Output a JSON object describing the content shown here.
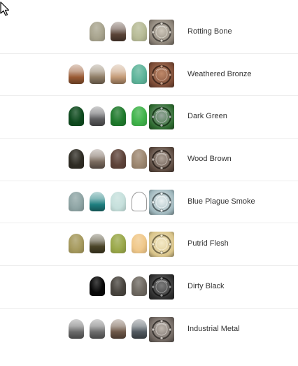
{
  "swatch_list": [
    {
      "name": "Rotting Bone",
      "paints": [
        {
          "style": "flat",
          "color": "#a8a48e"
        },
        {
          "style": "metal",
          "color": "#5a4438"
        },
        {
          "style": "flat",
          "color": "#b7bb96"
        }
      ],
      "mini": {
        "base": "#8a8176",
        "tint": "#cfc8bb"
      }
    },
    {
      "name": "Weathered Bronze",
      "paints": [
        {
          "style": "metal",
          "color": "#9a5a34"
        },
        {
          "style": "metal",
          "color": "#8f7d66"
        },
        {
          "style": "metal",
          "color": "#c49b77"
        },
        {
          "style": "flat",
          "color": "#5eb49a"
        }
      ],
      "mini": {
        "base": "#7a4a35",
        "tint": "#c08a6a"
      }
    },
    {
      "name": "Dark Green",
      "paints": [
        {
          "style": "flat",
          "color": "#0e4a1e"
        },
        {
          "style": "metal",
          "color": "#5e5e60"
        },
        {
          "style": "flat",
          "color": "#1f7a2c"
        },
        {
          "style": "flat",
          "color": "#3fb34a"
        }
      ],
      "mini": {
        "base": "#2e6b30",
        "tint": "#9aa8a0"
      }
    },
    {
      "name": "Wood Brown",
      "paints": [
        {
          "style": "flat",
          "color": "#2f2c24"
        },
        {
          "style": "metal",
          "color": "#7a6a5e"
        },
        {
          "style": "flat",
          "color": "#5e4339"
        },
        {
          "style": "flat",
          "color": "#9d8770"
        }
      ],
      "mini": {
        "base": "#5c4a40",
        "tint": "#b0a49a"
      }
    },
    {
      "name": "Blue Plague Smoke",
      "paints": [
        {
          "style": "flat",
          "color": "#8fa5a5"
        },
        {
          "style": "metal",
          "color": "#1f7f80"
        },
        {
          "style": "flat",
          "color": "#c6e0dc"
        },
        {
          "style": "outline",
          "color": "#ffffff"
        }
      ],
      "mini": {
        "base": "#9fb7bd",
        "tint": "#eaf1f2"
      }
    },
    {
      "name": "Putrid Flesh",
      "paints": [
        {
          "style": "flat",
          "color": "#a69a5e"
        },
        {
          "style": "metal",
          "color": "#4a4428"
        },
        {
          "style": "flat",
          "color": "#9aa84a"
        },
        {
          "style": "flat",
          "color": "#f0c88a"
        }
      ],
      "mini": {
        "base": "#d9c48a",
        "tint": "#f4eac8"
      }
    },
    {
      "name": "Dirty Black",
      "paints": [
        {
          "style": "flat",
          "color": "#080808"
        },
        {
          "style": "flat",
          "color": "#48443e"
        },
        {
          "style": "flat",
          "color": "#6e6860"
        }
      ],
      "mini": {
        "base": "#2e2e2e",
        "tint": "#7e7e7e"
      }
    },
    {
      "name": "Industrial Metal",
      "paints": [
        {
          "style": "metal",
          "color": "#6a6a6a"
        },
        {
          "style": "metal",
          "color": "#6d6d6d"
        },
        {
          "style": "metal",
          "color": "#6e5848"
        },
        {
          "style": "metal",
          "color": "#515960"
        }
      ],
      "mini": {
        "base": "#6e655f",
        "tint": "#c0b8b0"
      }
    }
  ]
}
